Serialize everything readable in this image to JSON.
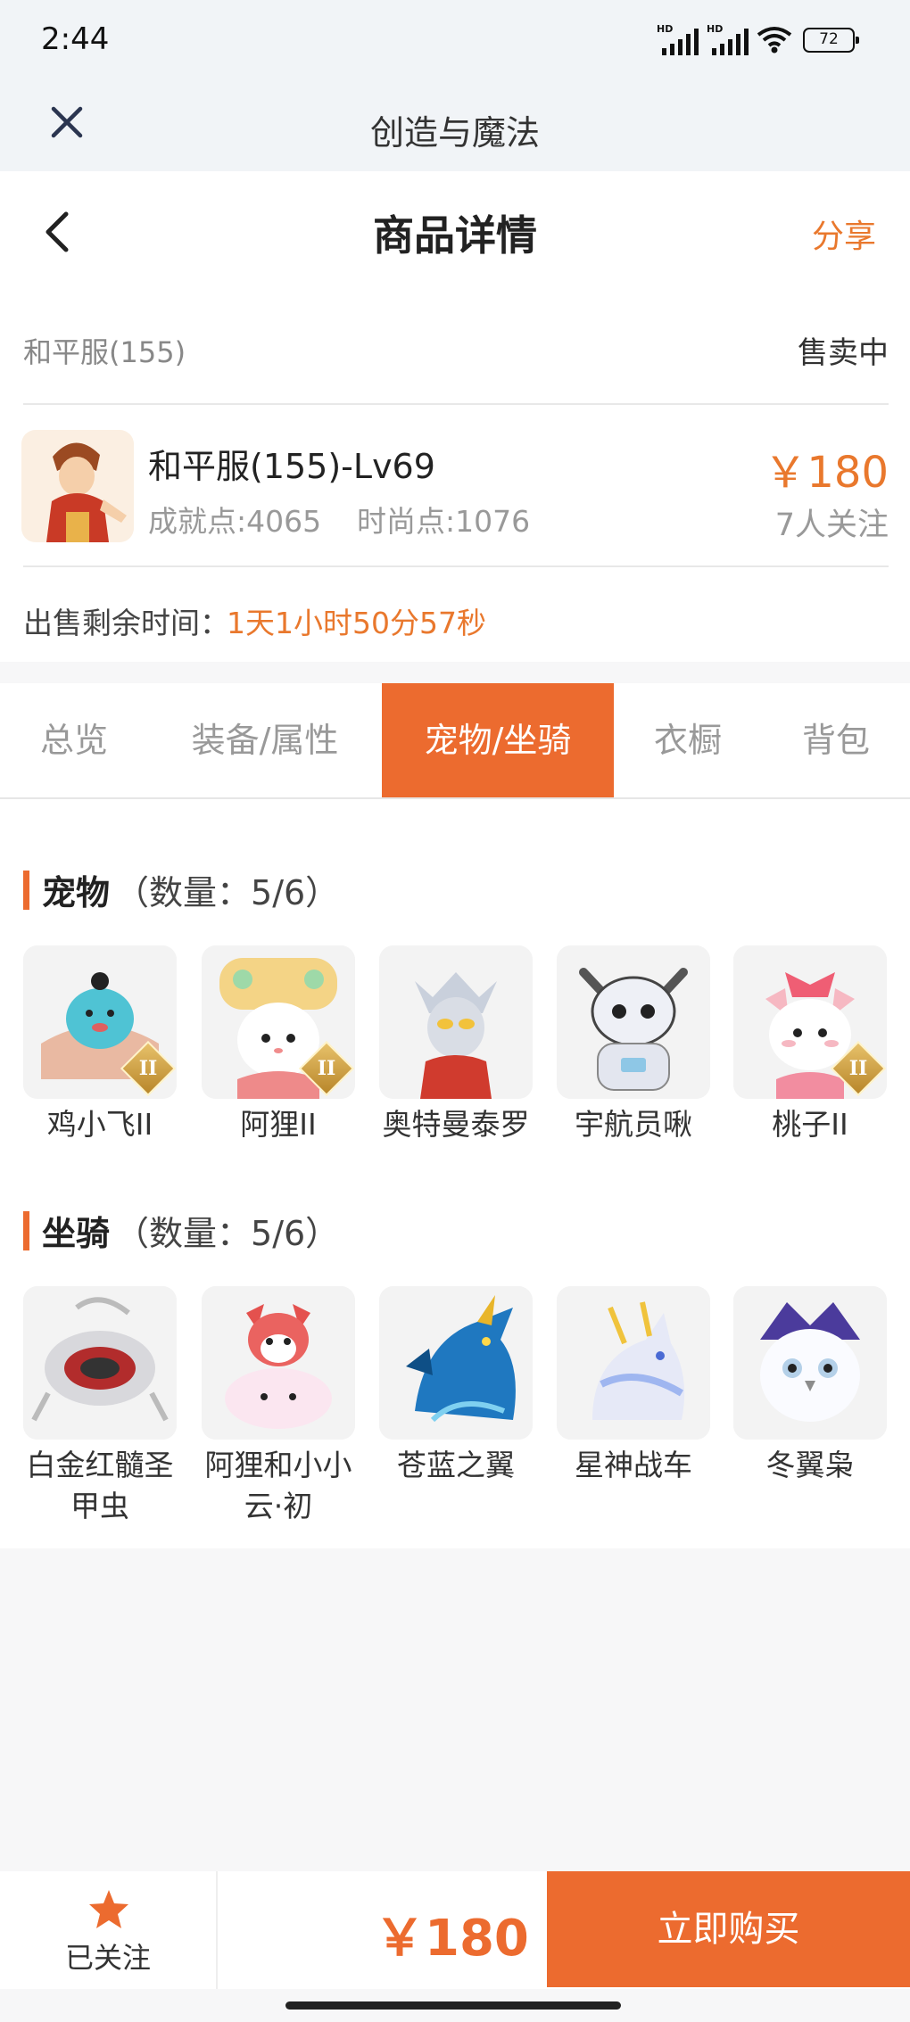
{
  "status_bar": {
    "time": "2:44",
    "signal1_label": "HD",
    "signal2_label": "HD",
    "battery": "72"
  },
  "app_bar": {
    "title": "创造与魔法",
    "close_icon": "close-icon"
  },
  "header": {
    "title": "商品详情",
    "share": "分享",
    "back_icon": "chevron-left-icon"
  },
  "listing": {
    "server": "和平服(155)",
    "status": "售卖中",
    "role_name": "和平服(155)-Lv69",
    "achievement": "成就点:4065",
    "fashion": "时尚点:1076",
    "price": "￥180",
    "followers": "7人关注",
    "remain_label": "出售剩余时间：",
    "remain_value": "1天1小时50分57秒"
  },
  "tabs": [
    {
      "label": "总览"
    },
    {
      "label": "装备/属性"
    },
    {
      "label": "宠物/坐骑"
    },
    {
      "label": "衣橱"
    },
    {
      "label": "背包"
    }
  ],
  "active_tab": "宠物/坐骑",
  "pets": {
    "title": "宠物",
    "count": "（数量：5/6）",
    "items": [
      {
        "name": "鸡小飞II",
        "badge": "II"
      },
      {
        "name": "阿狸II",
        "badge": "II"
      },
      {
        "name": "奥特曼泰罗"
      },
      {
        "name": "宇航员啾"
      },
      {
        "name": "桃子II",
        "badge": "II"
      }
    ]
  },
  "mounts": {
    "title": "坐骑",
    "count": "（数量：5/6）",
    "items": [
      {
        "name": "白金红髓圣甲虫"
      },
      {
        "name": "阿狸和小小云·初"
      },
      {
        "name": "苍蓝之翼"
      },
      {
        "name": "星神战车"
      },
      {
        "name": "冬翼枭"
      }
    ]
  },
  "bottom_bar": {
    "follow_label": "已关注",
    "price": "￥180",
    "buy": "立即购买"
  },
  "colors": {
    "accent": "#ec6b2f",
    "price": "#e9782d"
  }
}
